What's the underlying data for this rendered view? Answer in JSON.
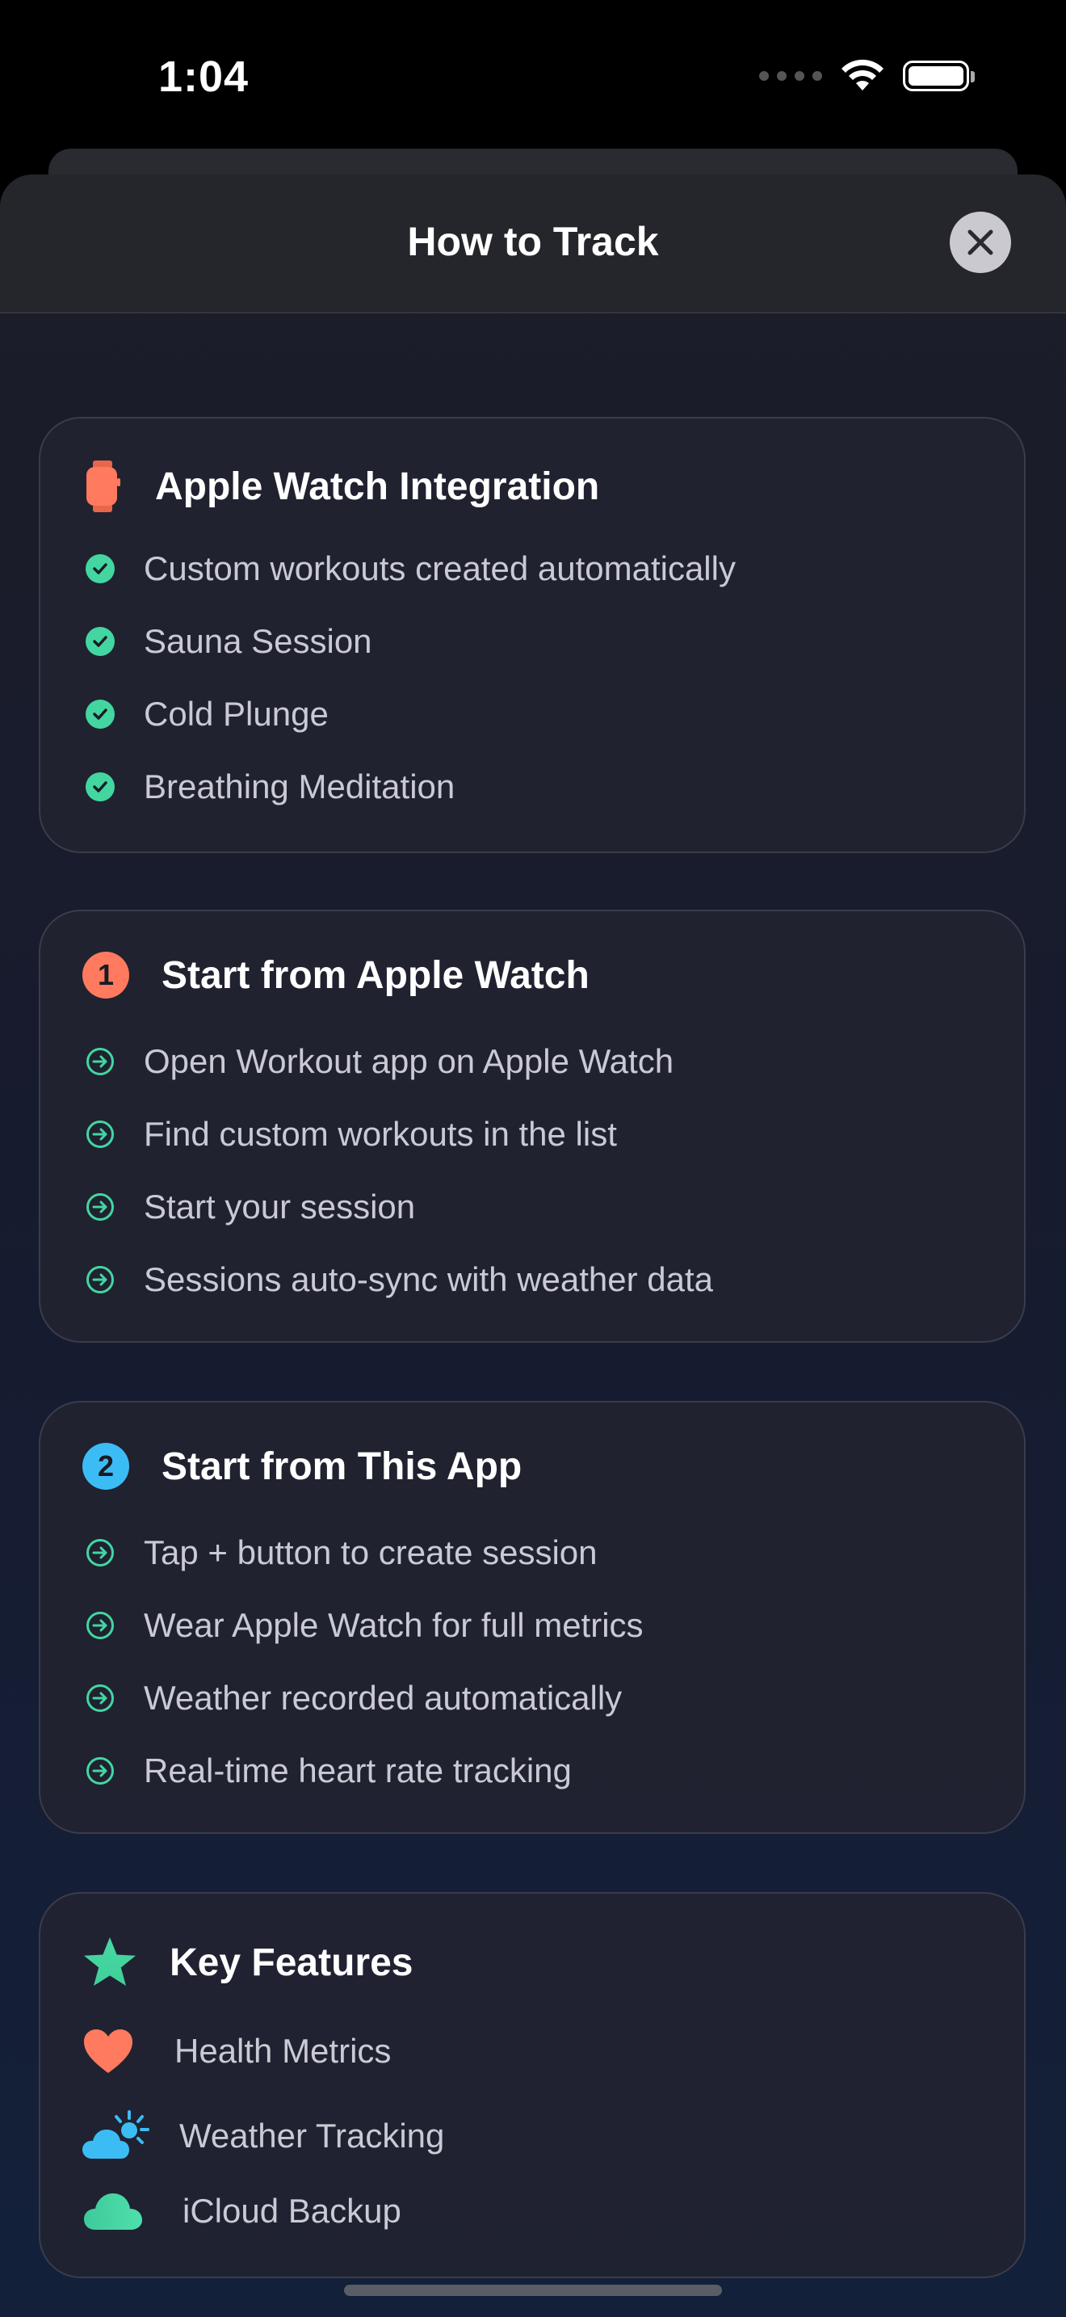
{
  "status_bar": {
    "time": "1:04"
  },
  "sheet": {
    "title": "How to Track",
    "close_icon": "xmark-icon"
  },
  "cards": {
    "watch": {
      "title": "Apple Watch Integration",
      "icon": "applewatch-icon",
      "items": [
        "Custom workouts created automatically",
        "Sauna Session",
        "Cold Plunge",
        "Breathing Meditation"
      ]
    },
    "from_watch": {
      "badge": "1",
      "title": "Start from Apple Watch",
      "items": [
        "Open Workout app on Apple Watch",
        "Find custom workouts in the list",
        "Start your session",
        "Sessions auto-sync with weather data"
      ]
    },
    "from_app": {
      "badge": "2",
      "title": "Start from This App",
      "items": [
        "Tap + button to create session",
        "Wear Apple Watch for full metrics",
        "Weather recorded automatically",
        "Real-time heart rate tracking"
      ]
    },
    "features": {
      "title": "Key Features",
      "items": [
        "Health Metrics",
        "Weather Tracking",
        "iCloud Backup"
      ]
    }
  },
  "colors": {
    "accent_green": "#43d6a1",
    "badge_one": "#ff7a5e",
    "badge_two": "#3cbcf5",
    "watch_orange": "#ff7a5e"
  }
}
